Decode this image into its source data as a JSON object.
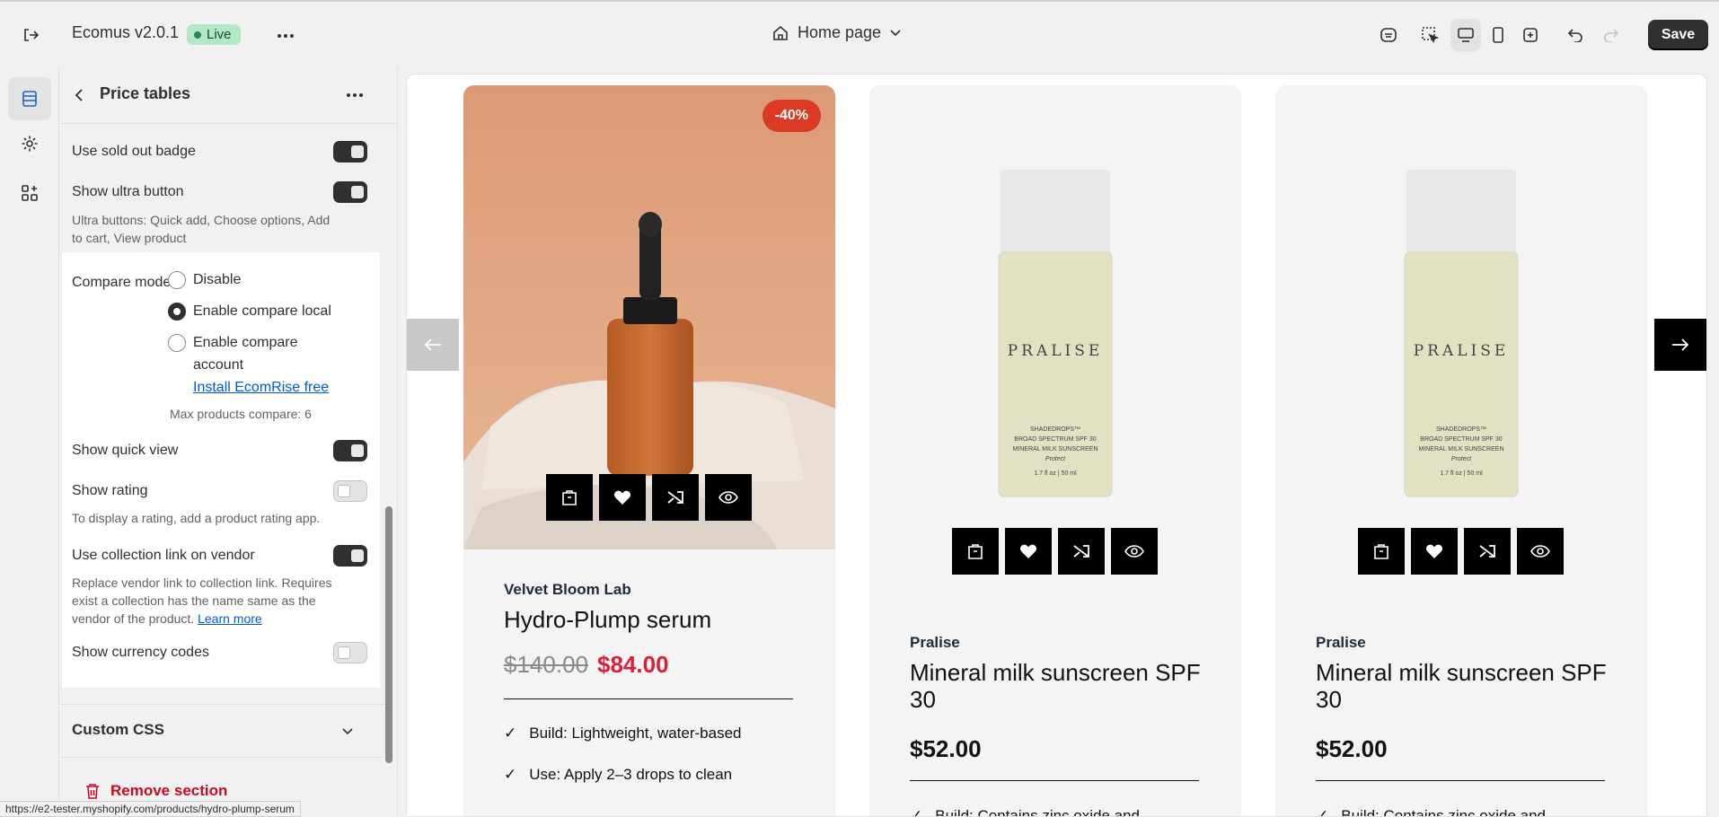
{
  "app": {
    "title": "Ecomus v2.0.1",
    "status": "Live"
  },
  "page_selector": {
    "label": "Home page"
  },
  "toolbar": {
    "save_label": "Save"
  },
  "panel": {
    "title": "Price tables",
    "settings": [
      {
        "label": "Use sold out badge",
        "on": true
      },
      {
        "label": "Show ultra button",
        "on": true,
        "help": "Ultra buttons: Quick add, Choose options, Add to cart, View product"
      }
    ],
    "compare": {
      "label": "Compare mode",
      "options": [
        "Disable",
        "Enable compare local",
        "Enable compare account"
      ],
      "selected": "Enable compare local",
      "install_link": "Install EcomRise free",
      "max_note": "Max products compare: 6"
    },
    "more_settings": [
      {
        "label": "Show quick view",
        "on": true
      },
      {
        "label": "Show rating",
        "on": false,
        "help": "To display a rating, add a product rating app."
      },
      {
        "label": "Use collection link on vendor",
        "on": true,
        "help": "Replace vendor link to collection link. Requires exist a collection has the name same as the vendor of the product.",
        "link": "Learn more"
      },
      {
        "label": "Show currency codes",
        "on": false
      }
    ],
    "custom_css": "Custom CSS",
    "remove_section": "Remove section"
  },
  "status_url": "https://e2-tester.myshopify.com/products/hydro-plump-serum",
  "preview": {
    "products": [
      {
        "badge": "-40%",
        "vendor": "Velvet Bloom Lab",
        "name": "Hydro-Plump serum",
        "price_old": "$140.00",
        "price": "$84.00",
        "features": [
          "Build: Lightweight, water-based",
          "Use: Apply 2–3 drops to clean"
        ]
      },
      {
        "vendor": "Pralise",
        "name": "Mineral milk sunscreen SPF 30",
        "price": "$52.00",
        "features": [
          "Build: Contains zinc oxide and"
        ]
      },
      {
        "vendor": "Pralise",
        "name": "Mineral milk sunscreen SPF 30",
        "price": "$52.00",
        "features": [
          "Build: Contains zinc oxide and"
        ]
      }
    ],
    "bottle_brand": "PRALISE",
    "bottle_text": [
      "SHADEDROPS™",
      "BROAD SPECTRUM SPF 30",
      "MINERAL MILK SUNSCREEN",
      "Protect",
      "1.7 fl oz | 50 ml"
    ]
  },
  "colors": {
    "accent_dark": "#303030",
    "live_badge": "#b4e7c6",
    "sale": "#db3b25",
    "price_sale": "#db1f3b",
    "link": "#005bd3",
    "danger": "#c70a24"
  }
}
